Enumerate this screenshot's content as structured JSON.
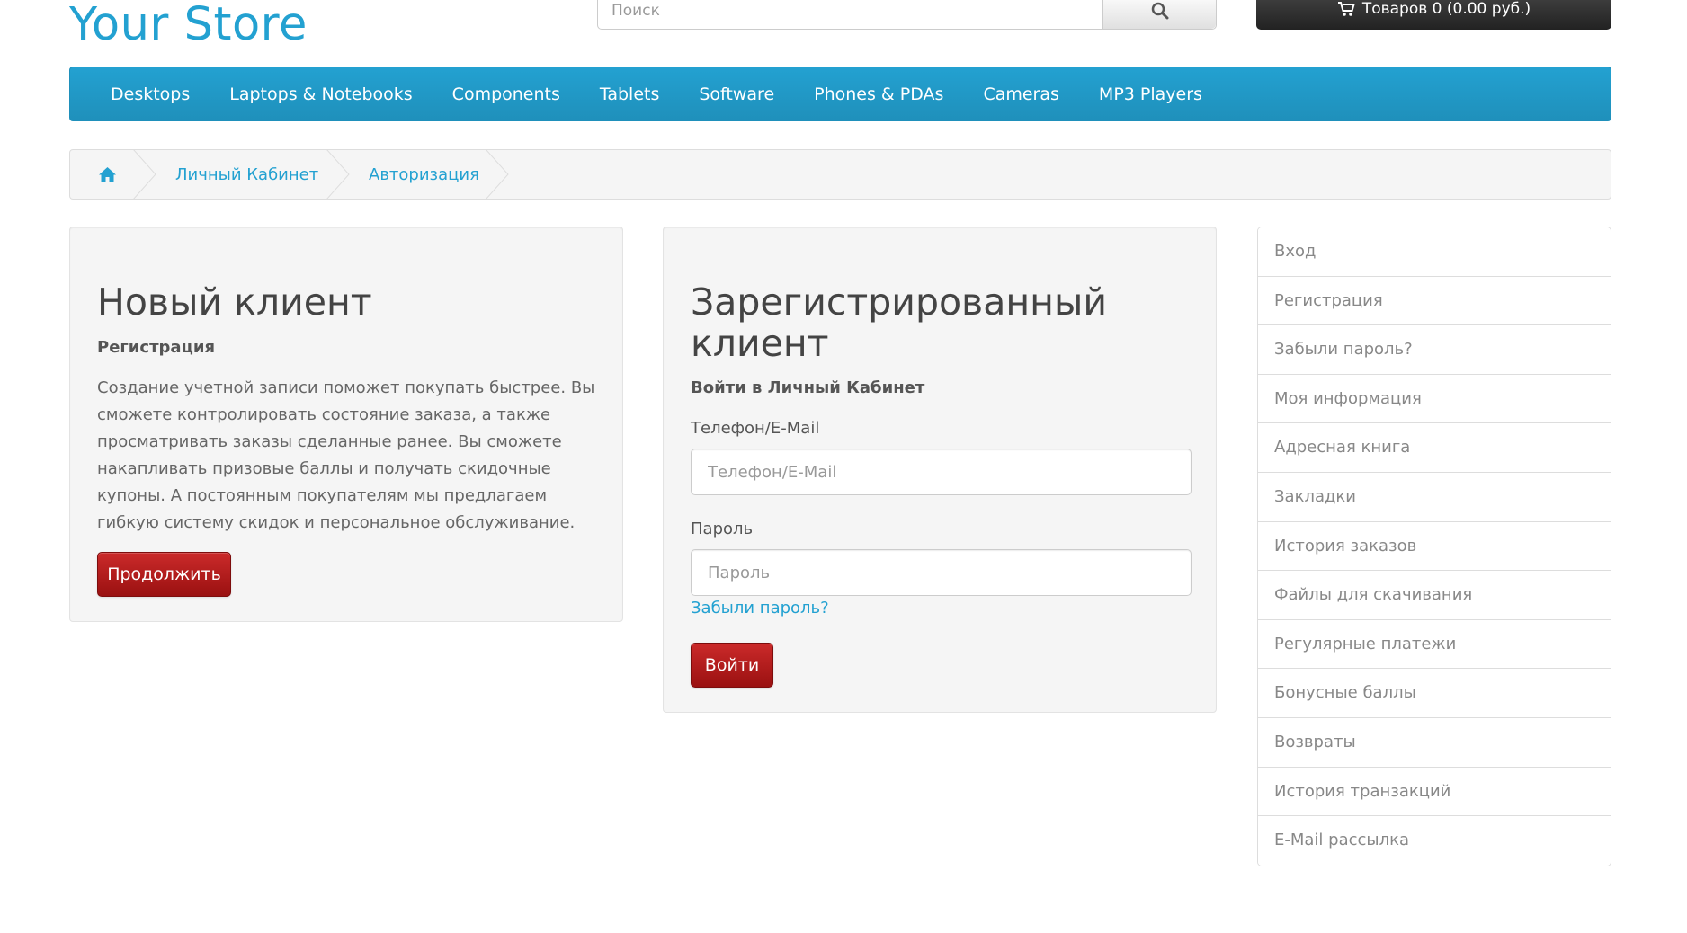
{
  "header": {
    "logo": "Your Store",
    "search_placeholder": "Поиск",
    "cart_label": "Товаров 0 (0.00 руб.)"
  },
  "nav": {
    "items": [
      "Desktops",
      "Laptops & Notebooks",
      "Components",
      "Tablets",
      "Software",
      "Phones & PDAs",
      "Cameras",
      "MP3 Players"
    ]
  },
  "breadcrumb": {
    "items": [
      "Личный Кабинет",
      "Авторизация"
    ]
  },
  "new_customer": {
    "title": "Новый клиент",
    "subtitle": "Регистрация",
    "text": "Создание учетной записи поможет покупать быстрее. Вы сможете контролировать состояние заказа, а также просматривать заказы сделанные ранее. Вы сможете накапливать призовые баллы и получать скидочные купоны. А постоянным покупателям мы предлагаем гибкую систему скидок и персональное обслуживание.",
    "button": "Продолжить"
  },
  "returning_customer": {
    "title": "Зарегистрированный клиент",
    "subtitle": "Войти в Личный Кабинет",
    "login_label": "Телефон/E-Mail",
    "login_placeholder": "Телефон/E-Mail",
    "password_label": "Пароль",
    "password_placeholder": "Пароль",
    "forgot_link": "Забыли пароль?",
    "button": "Войти"
  },
  "account_menu": {
    "items": [
      "Вход",
      "Регистрация",
      "Забыли пароль?",
      "Моя информация",
      "Адресная книга",
      "Закладки",
      "История заказов",
      "Файлы для скачивания",
      "Регулярные платежи",
      "Бонусные баллы",
      "Возвраты",
      "История транзакций",
      "E-Mail рассылка"
    ]
  },
  "colors": {
    "brand": "#23a1d1",
    "button_red": "#b21d1d",
    "cart_dark": "#333333"
  },
  "icons": {
    "search": "search-icon",
    "cart": "cart-icon",
    "home": "home-icon"
  }
}
